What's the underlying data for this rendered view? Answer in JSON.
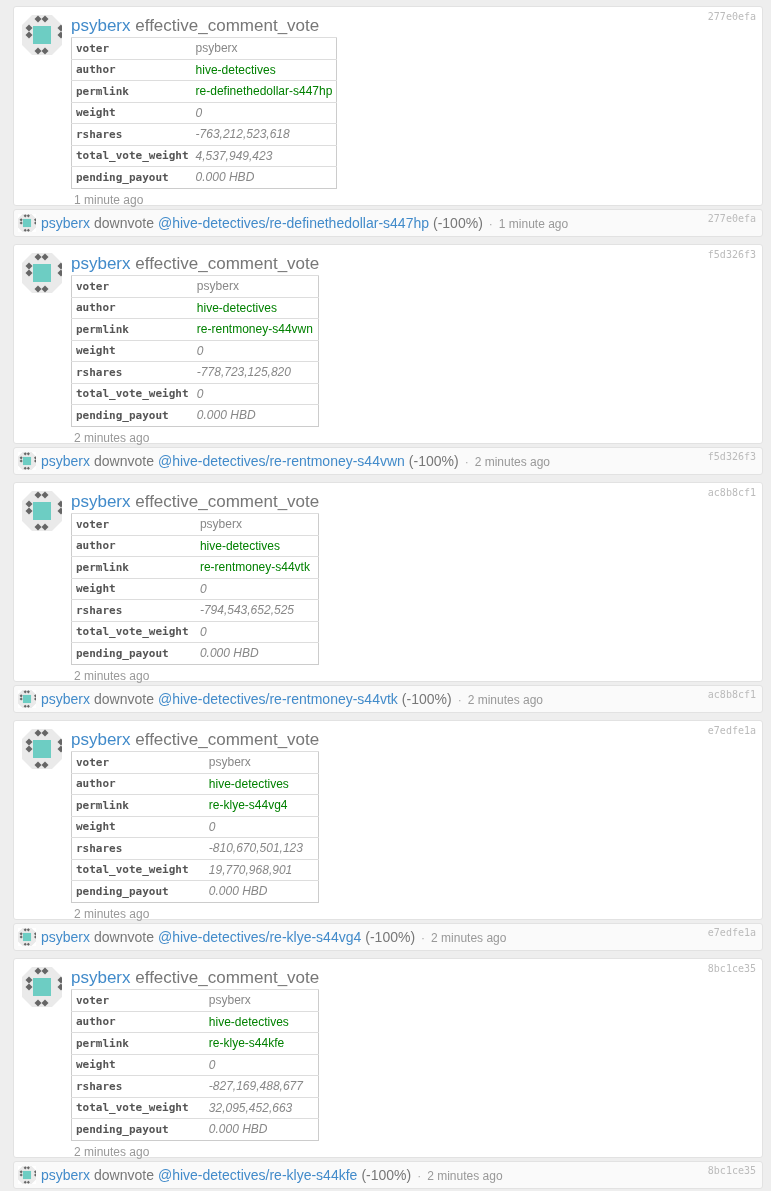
{
  "entries": [
    {
      "card": {
        "account": "psyberx",
        "op": "effective_comment_vote",
        "hash": "277e0efa",
        "time": "1 minute ago",
        "fields": [
          {
            "key": "voter",
            "value": "psyberx",
            "kind": "plain"
          },
          {
            "key": "author",
            "value": "hive-detectives",
            "kind": "link"
          },
          {
            "key": "permlink",
            "value": "re-definethedollar-s447hp",
            "kind": "link"
          },
          {
            "key": "weight",
            "value": "0",
            "kind": "number"
          },
          {
            "key": "rshares",
            "value": "-763,212,523,618",
            "kind": "number"
          },
          {
            "key": "total_vote_weight",
            "value": "4,537,949,423",
            "kind": "number"
          },
          {
            "key": "pending_payout",
            "value": "0.000 HBD",
            "kind": "number"
          }
        ]
      },
      "summary": {
        "account": "psyberx",
        "action": "downvote",
        "target": "@hive-detectives/re-definethedollar-s447hp",
        "percent": "(-100%)",
        "separator": "·",
        "time": "1 minute ago",
        "hash": "277e0efa"
      }
    },
    {
      "card": {
        "account": "psyberx",
        "op": "effective_comment_vote",
        "hash": "f5d326f3",
        "time": "2 minutes ago",
        "fields": [
          {
            "key": "voter",
            "value": "psyberx",
            "kind": "plain"
          },
          {
            "key": "author",
            "value": "hive-detectives",
            "kind": "link"
          },
          {
            "key": "permlink",
            "value": "re-rentmoney-s44vwn",
            "kind": "link"
          },
          {
            "key": "weight",
            "value": "0",
            "kind": "number"
          },
          {
            "key": "rshares",
            "value": "-778,723,125,820",
            "kind": "number"
          },
          {
            "key": "total_vote_weight",
            "value": "0",
            "kind": "number"
          },
          {
            "key": "pending_payout",
            "value": "0.000 HBD",
            "kind": "number"
          }
        ]
      },
      "summary": {
        "account": "psyberx",
        "action": "downvote",
        "target": "@hive-detectives/re-rentmoney-s44vwn",
        "percent": "(-100%)",
        "separator": "·",
        "time": "2 minutes ago",
        "hash": "f5d326f3"
      }
    },
    {
      "card": {
        "account": "psyberx",
        "op": "effective_comment_vote",
        "hash": "ac8b8cf1",
        "time": "2 minutes ago",
        "fields": [
          {
            "key": "voter",
            "value": "psyberx",
            "kind": "plain"
          },
          {
            "key": "author",
            "value": "hive-detectives",
            "kind": "link"
          },
          {
            "key": "permlink",
            "value": "re-rentmoney-s44vtk",
            "kind": "link"
          },
          {
            "key": "weight",
            "value": "0",
            "kind": "number"
          },
          {
            "key": "rshares",
            "value": "-794,543,652,525",
            "kind": "number"
          },
          {
            "key": "total_vote_weight",
            "value": "0",
            "kind": "number"
          },
          {
            "key": "pending_payout",
            "value": "0.000 HBD",
            "kind": "number"
          }
        ]
      },
      "summary": {
        "account": "psyberx",
        "action": "downvote",
        "target": "@hive-detectives/re-rentmoney-s44vtk",
        "percent": "(-100%)",
        "separator": "·",
        "time": "2 minutes ago",
        "hash": "ac8b8cf1"
      }
    },
    {
      "card": {
        "account": "psyberx",
        "op": "effective_comment_vote",
        "hash": "e7edfe1a",
        "time": "2 minutes ago",
        "fields": [
          {
            "key": "voter",
            "value": "psyberx",
            "kind": "plain"
          },
          {
            "key": "author",
            "value": "hive-detectives",
            "kind": "link"
          },
          {
            "key": "permlink",
            "value": "re-klye-s44vg4",
            "kind": "link"
          },
          {
            "key": "weight",
            "value": "0",
            "kind": "number"
          },
          {
            "key": "rshares",
            "value": "-810,670,501,123",
            "kind": "number"
          },
          {
            "key": "total_vote_weight",
            "value": "19,770,968,901",
            "kind": "number"
          },
          {
            "key": "pending_payout",
            "value": "0.000 HBD",
            "kind": "number"
          }
        ]
      },
      "summary": {
        "account": "psyberx",
        "action": "downvote",
        "target": "@hive-detectives/re-klye-s44vg4",
        "percent": "(-100%)",
        "separator": "·",
        "time": "2 minutes ago",
        "hash": "e7edfe1a"
      }
    },
    {
      "card": {
        "account": "psyberx",
        "op": "effective_comment_vote",
        "hash": "8bc1ce35",
        "time": "2 minutes ago",
        "fields": [
          {
            "key": "voter",
            "value": "psyberx",
            "kind": "plain"
          },
          {
            "key": "author",
            "value": "hive-detectives",
            "kind": "link"
          },
          {
            "key": "permlink",
            "value": "re-klye-s44kfe",
            "kind": "link"
          },
          {
            "key": "weight",
            "value": "0",
            "kind": "number"
          },
          {
            "key": "rshares",
            "value": "-827,169,488,677",
            "kind": "number"
          },
          {
            "key": "total_vote_weight",
            "value": "32,095,452,663",
            "kind": "number"
          },
          {
            "key": "pending_payout",
            "value": "0.000 HBD",
            "kind": "number"
          }
        ]
      },
      "summary": {
        "account": "psyberx",
        "action": "downvote",
        "target": "@hive-detectives/re-klye-s44kfe",
        "percent": "(-100%)",
        "separator": "·",
        "time": "2 minutes ago",
        "hash": "8bc1ce35"
      }
    }
  ]
}
